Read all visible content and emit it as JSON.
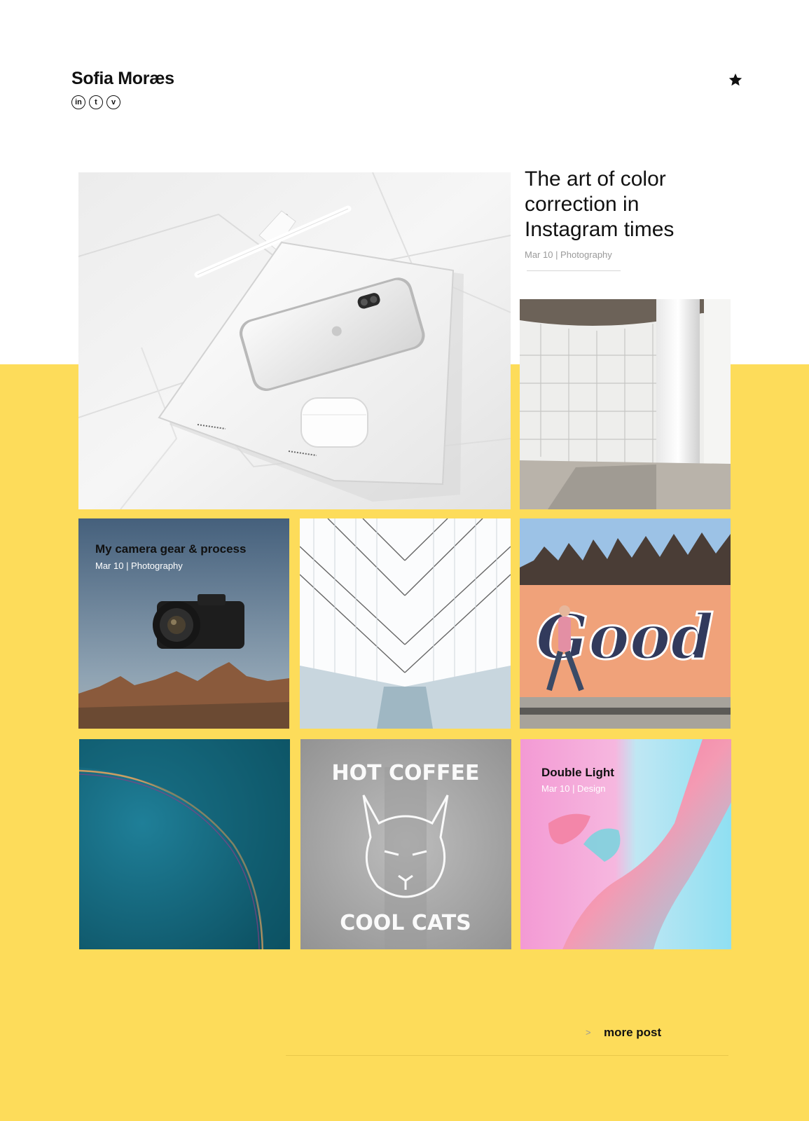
{
  "header": {
    "brand": "Sofia Moræs",
    "socials": [
      {
        "label": "in",
        "icon": "linkedin-icon"
      },
      {
        "label": "t",
        "icon": "tumblr-icon"
      },
      {
        "label": "v",
        "icon": "vimeo-icon"
      }
    ],
    "star_icon": "star-icon"
  },
  "featured": {
    "title": "The art of color correction in Instagram times",
    "meta": "Mar 10 | Photography",
    "image": "tablet-phone-pencil-on-paper"
  },
  "posts": [
    {
      "id": "architecture-columns",
      "image": "white-architecture-column"
    },
    {
      "id": "camera-gear",
      "title": "My camera gear & process",
      "meta": "Mar 10 | Photography",
      "image": "floating-camera-desert"
    },
    {
      "id": "white-hall",
      "image": "white-symmetric-hall"
    },
    {
      "id": "good-mural",
      "image": "good-graffiti-mural-walker"
    },
    {
      "id": "teal-abstract",
      "image": "teal-surface-rainbow"
    },
    {
      "id": "hot-coffee",
      "image": "hot-coffee-cool-cats-sign",
      "sign_top": "HOT COFFEE",
      "sign_bottom": "COOL CATS"
    },
    {
      "id": "double-light",
      "title": "Double Light",
      "meta": "Mar 10 | Design",
      "image": "pink-cyan-hand"
    }
  ],
  "mural_text": "Good",
  "more": {
    "arrow": ">",
    "label": "more post"
  },
  "colors": {
    "accent_yellow": "#fddc5a",
    "text": "#111111",
    "meta_gray": "#9a9a9a"
  }
}
